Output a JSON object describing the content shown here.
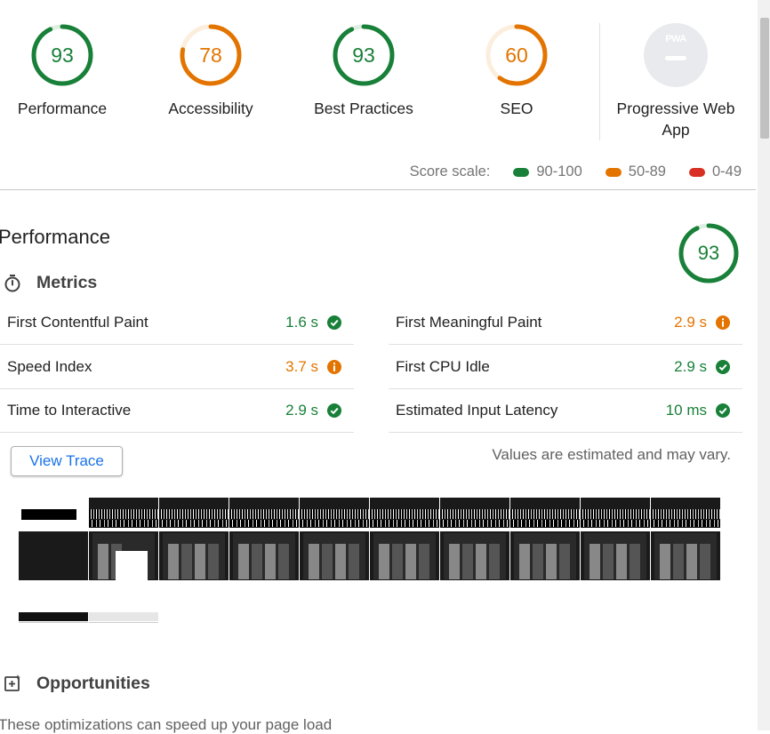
{
  "colors": {
    "pass": "#188038",
    "average": "#e37400",
    "fail": "#d93025",
    "pass_track": "#dff0e3",
    "average_track": "#fbeedc",
    "link": "#1a73e8"
  },
  "summary": [
    {
      "label": "Performance",
      "score": "93",
      "rating": "pass"
    },
    {
      "label": "Accessibility",
      "score": "78",
      "rating": "average"
    },
    {
      "label": "Best Practices",
      "score": "93",
      "rating": "pass"
    },
    {
      "label": "SEO",
      "score": "60",
      "rating": "average"
    }
  ],
  "pwa": {
    "badge_text": "PWA",
    "label": "Progressive Web App"
  },
  "score_scale": {
    "label": "Score scale:",
    "pass": "90-100",
    "average": "50-89",
    "fail": "0-49"
  },
  "performance": {
    "title": "Performance",
    "score": "93",
    "metrics_heading": "Metrics",
    "metrics_left": [
      {
        "label": "First Contentful Paint",
        "value": "1.6 s",
        "rating": "pass",
        "icon": "check-circle-icon"
      },
      {
        "label": "Speed Index",
        "value": "3.7 s",
        "rating": "average",
        "icon": "info-circle-icon"
      },
      {
        "label": "Time to Interactive",
        "value": "2.9 s",
        "rating": "pass",
        "icon": "check-circle-icon"
      }
    ],
    "metrics_right": [
      {
        "label": "First Meaningful Paint",
        "value": "2.9 s",
        "rating": "average",
        "icon": "info-circle-icon"
      },
      {
        "label": "First CPU Idle",
        "value": "2.9 s",
        "rating": "pass",
        "icon": "check-circle-icon"
      },
      {
        "label": "Estimated Input Latency",
        "value": "10 ms",
        "rating": "pass",
        "icon": "check-circle-icon"
      }
    ],
    "view_trace_label": "View Trace",
    "estimate_note": "Values are estimated and may vary.",
    "filmstrip_count": 10
  },
  "opportunities": {
    "heading": "Opportunities",
    "subtitle": "These optimizations can speed up your page load"
  }
}
